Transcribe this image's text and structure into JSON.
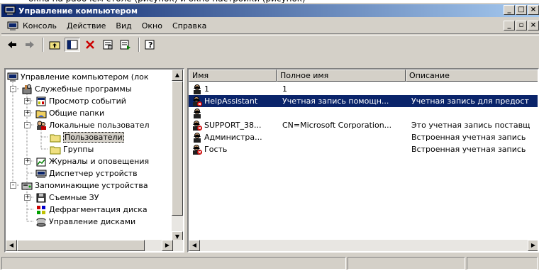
{
  "window": {
    "title": "Управление компьютером",
    "btn_minimize": "_",
    "btn_maximize": "□",
    "btn_close": "×"
  },
  "menubar": {
    "items": [
      "Консоль",
      "Действие",
      "Вид",
      "Окно",
      "Справка"
    ],
    "btn_minimize": "_",
    "btn_restore": "▫",
    "btn_close": "×"
  },
  "tree": {
    "items": [
      {
        "label": "Управление компьютером (лок",
        "icon": "computer-icon"
      },
      {
        "label": "Служебные программы",
        "icon": "tools-icon"
      },
      {
        "label": "Просмотр событий",
        "icon": "event-viewer-icon"
      },
      {
        "label": "Общие папки",
        "icon": "shared-folders-icon"
      },
      {
        "label": "Локальные пользовател",
        "icon": "users-icon"
      },
      {
        "label": "Пользователи",
        "icon": "folder-icon"
      },
      {
        "label": "Группы",
        "icon": "folder-icon"
      },
      {
        "label": "Журналы и оповещения",
        "icon": "logs-icon"
      },
      {
        "label": "Диспетчер устройств",
        "icon": "device-manager-icon"
      },
      {
        "label": "Запоминающие устройства",
        "icon": "storage-icon"
      },
      {
        "label": "Съемные ЗУ",
        "icon": "removable-storage-icon"
      },
      {
        "label": "Дефрагментация диска",
        "icon": "defrag-icon"
      },
      {
        "label": "Управление дисками",
        "icon": "disk-management-icon"
      }
    ]
  },
  "list": {
    "columns": [
      "Имя",
      "Полное имя",
      "Описание"
    ],
    "rows": [
      {
        "name": "1",
        "fullname": "1",
        "description": "",
        "icon": "user-icon",
        "selected": false
      },
      {
        "name": "HelpAssistant",
        "fullname": "Учетная запись помощн...",
        "description": "Учетная запись для предост",
        "icon": "user-disabled-icon",
        "selected": true
      },
      {
        "name": "",
        "fullname": "",
        "description": "",
        "icon": "user-icon",
        "selected": false
      },
      {
        "name": "SUPPORT_38...",
        "fullname": "CN=Microsoft Corporation...",
        "description": "Это учетная запись поставщ",
        "icon": "user-disabled-icon",
        "selected": false
      },
      {
        "name": "Администра...",
        "fullname": "",
        "description": "Встроенная учетная запись",
        "icon": "user-icon",
        "selected": false
      },
      {
        "name": "Гость",
        "fullname": "",
        "description": "Встроенная учетная запись",
        "icon": "user-disabled-icon",
        "selected": false
      }
    ]
  },
  "colors": {
    "title_start": "#0a246a",
    "title_end": "#a6caf0",
    "selection": "#0a246a",
    "chrome": "#d4d0c8"
  }
}
